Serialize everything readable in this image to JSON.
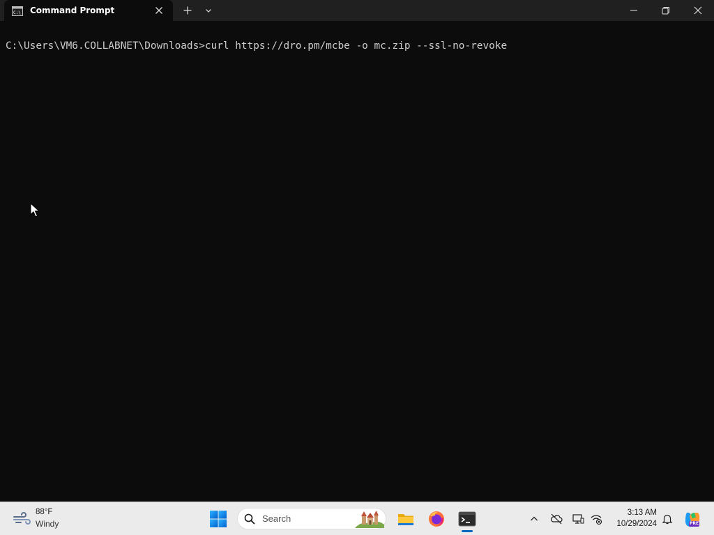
{
  "window": {
    "tab_title": "Command Prompt",
    "tab_icon": "cmd-icon",
    "controls": [
      "minimize-icon",
      "maximize-icon",
      "close-icon"
    ]
  },
  "console": {
    "lines": [
      "C:\\Users\\VM6.COLLABNET\\Downloads>curl https://dro.pm/mcbe -o mc.zip --ssl-no-revoke"
    ]
  },
  "taskbar": {
    "weather": {
      "temperature": "88°F",
      "condition": "Windy",
      "icon": "windy-weather-icon"
    },
    "search": {
      "placeholder": "Search"
    },
    "apps": [
      {
        "name": "File Explorer",
        "icon": "folder-icon",
        "active": false
      },
      {
        "name": "Firefox",
        "icon": "firefox-icon",
        "active": false
      },
      {
        "name": "Terminal",
        "icon": "terminal-icon",
        "active": true
      }
    ],
    "tray": [
      "chevron-up-icon",
      "onedrive-icon",
      "display-icon",
      "network-icon"
    ],
    "clock": {
      "time": "3:13 AM",
      "date": "10/29/2024"
    },
    "copilot_badge": "PRE"
  },
  "colors": {
    "console_bg": "#0c0c0c",
    "console_text": "#cccccc",
    "titlebar_bg": "#202020",
    "taskbar_bg": "#ebebeb",
    "accent": "#0067c0"
  }
}
